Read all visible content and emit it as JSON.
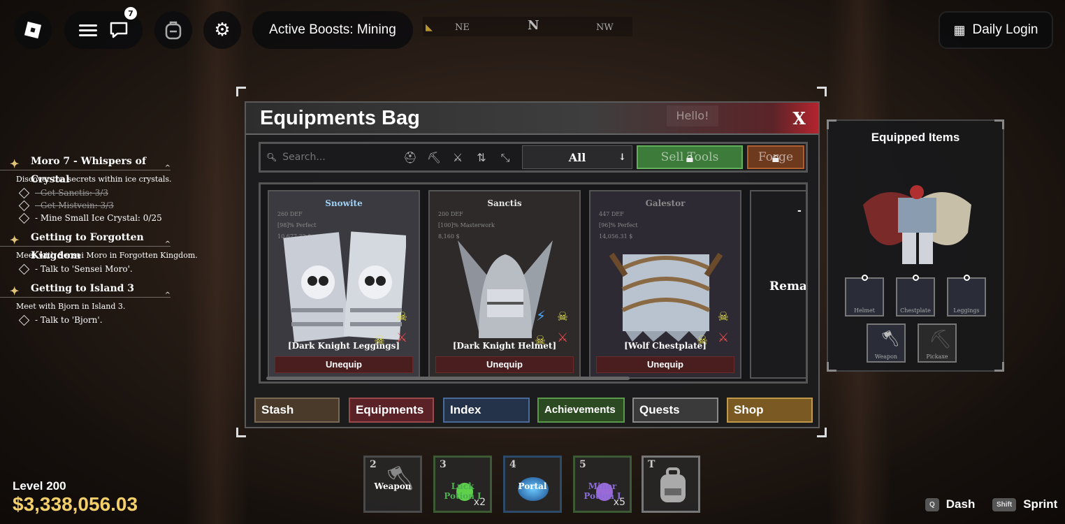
{
  "topbar": {
    "chat_badge": "7",
    "active_boosts": "Active Boosts: Mining",
    "daily_login": "Daily Login",
    "compass": [
      "NE",
      "N",
      "NW"
    ]
  },
  "quests": [
    {
      "title": "Moro 7 - Whispers of Crystal",
      "desc": "Discover the secrets within ice crystals.",
      "tasks": [
        {
          "text": "- Get Sanctis: 3/3",
          "done": true
        },
        {
          "text": "- Get Mistvein: 3/3",
          "done": true
        },
        {
          "text": "- Mine Small Ice Crystal: 0/25",
          "done": false
        }
      ]
    },
    {
      "title": "Getting to Forgotten Kingdom",
      "desc": "Meet with Sensei Moro in Forgotten Kingdom.",
      "tasks": [
        {
          "text": "- Talk to 'Sensei Moro'.",
          "done": false
        }
      ]
    },
    {
      "title": "Getting to Island 3",
      "desc": "Meet with Bjorn in Island 3.",
      "tasks": [
        {
          "text": "- Talk to 'Bjorn'.",
          "done": false
        }
      ]
    }
  ],
  "window": {
    "title": "Equipments Bag",
    "hello": "Hello!",
    "close": "X",
    "search_placeholder": "Search...",
    "filter": "All",
    "sell_label": "Sell Tools",
    "forge_label": "Forge"
  },
  "items": [
    {
      "rarity": "Snowite",
      "rarity_color": "#9fd3f5",
      "def": "260 DEF",
      "quality": "[98]% Perfect",
      "price": "10,677.32 $",
      "label": "[Dark Knight Leggings]",
      "button": "Unequip",
      "bg": "#3a3a40"
    },
    {
      "rarity": "Sanctis",
      "rarity_color": "#e6e6e6",
      "def": "200 DEF",
      "quality": "[100]% Masterwork",
      "price": "8,160 $",
      "label": "[Dark Knight Helmet]",
      "button": "Unequip",
      "bg": "#2e2a2a"
    },
    {
      "rarity": "Galestor",
      "rarity_color": "#8a8a8a",
      "def": "447 DEF",
      "quality": "[96]% Perfect",
      "price": "14,056.31 $",
      "label": "[Wolf Chestplate]",
      "button": "Unequip",
      "bg": "#2e2a34"
    }
  ],
  "partial_card": {
    "dash": "-",
    "text": "Remai"
  },
  "tabs": [
    {
      "label": "Stash",
      "color": "#4a3a2a",
      "border": "#7a6a55"
    },
    {
      "label": "Equipments",
      "color": "#5a2226",
      "border": "#9a4a4a"
    },
    {
      "label": "Index",
      "color": "#24324a",
      "border": "#4a6a9a"
    },
    {
      "label": "Achievements",
      "color": "#2c4a22",
      "border": "#5a9a4a"
    },
    {
      "label": "Quests",
      "color": "#3a3a3a",
      "border": "#8a8a8a"
    },
    {
      "label": "Shop",
      "color": "#7a5a22",
      "border": "#c09a4a"
    }
  ],
  "equipped": {
    "title": "Equipped Items",
    "slots": [
      "Helmet",
      "Chestplate",
      "Leggings",
      "Weapon",
      "Pickaxe"
    ]
  },
  "hotbar": [
    {
      "key": "2",
      "label": "Weapon",
      "count": "",
      "color": "#ddd"
    },
    {
      "key": "3",
      "label": "Luck Potion I",
      "count": "x2",
      "color": "#4caf50"
    },
    {
      "key": "4",
      "label": "Portal",
      "count": "",
      "color": "#ddd"
    },
    {
      "key": "5",
      "label": "Miner Potion I",
      "count": "x5",
      "color": "#8a6ad6"
    },
    {
      "key": "T",
      "label": "",
      "count": "",
      "color": "#ddd"
    }
  ],
  "player": {
    "level": "Level 200",
    "money": "$3,338,056.03"
  },
  "hints": {
    "dash_key": "Q",
    "dash": "Dash",
    "sprint_key": "Shift",
    "sprint": "Sprint"
  }
}
